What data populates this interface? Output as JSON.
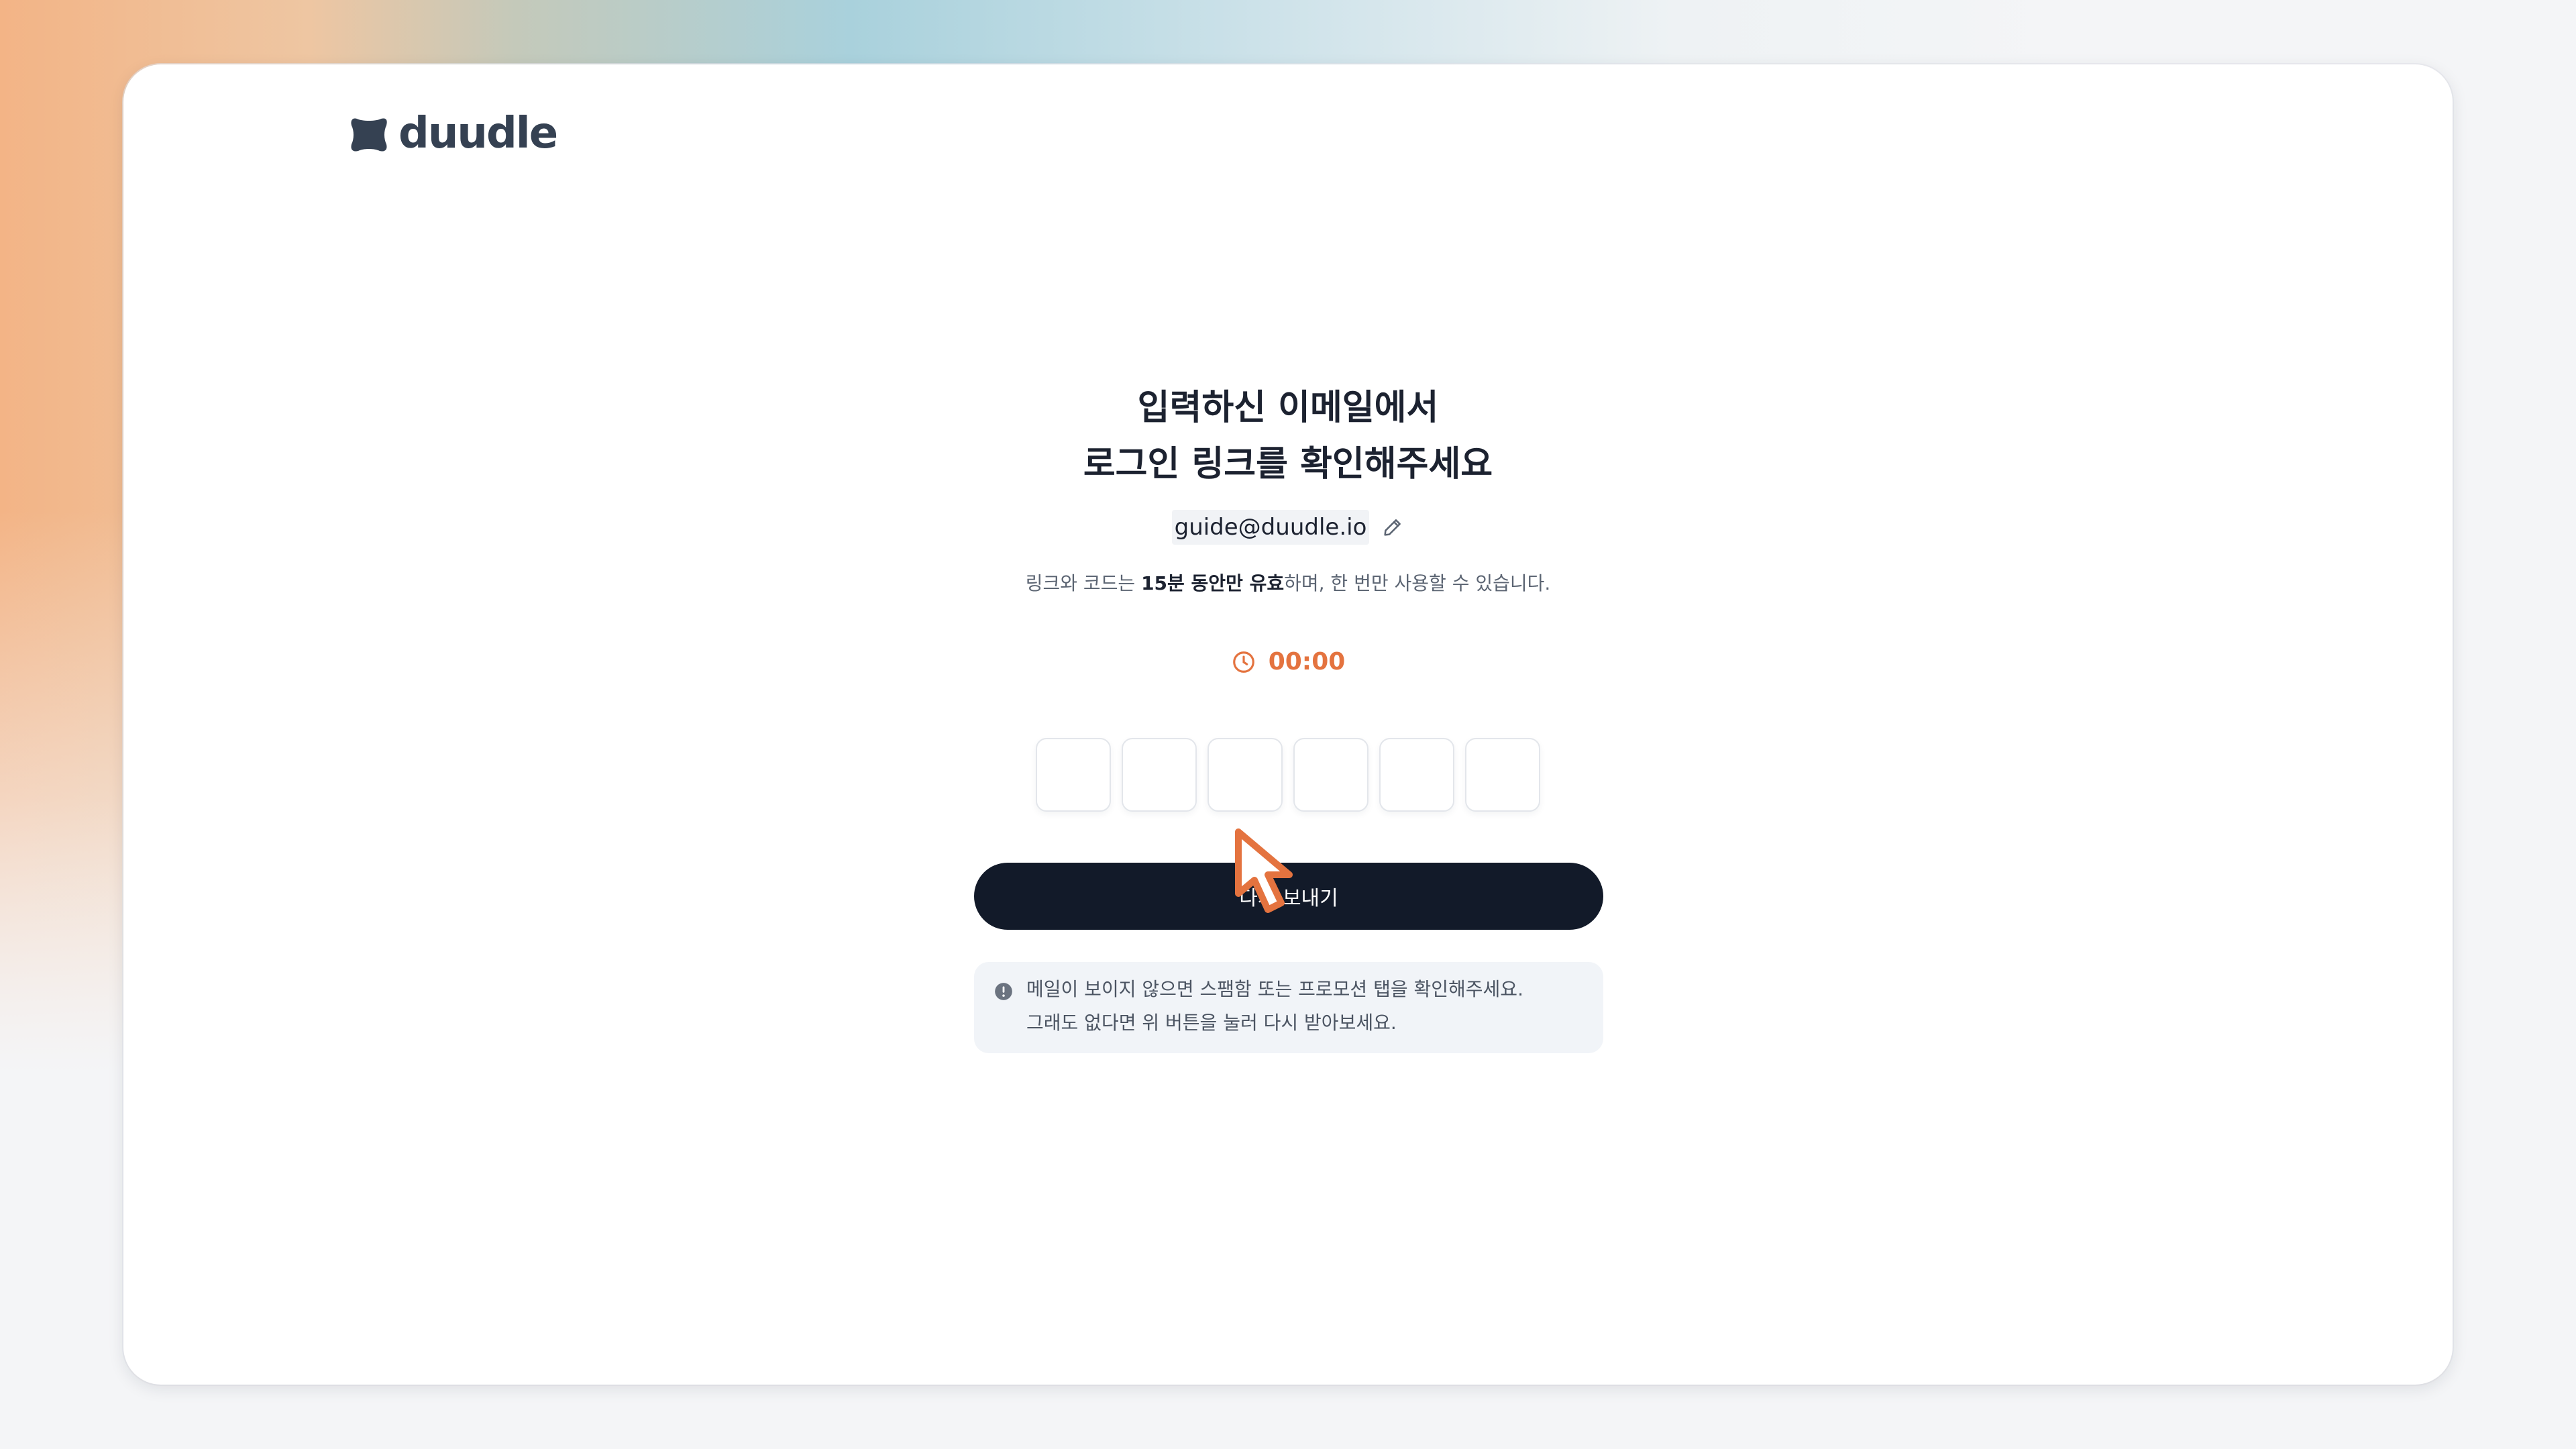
{
  "brand": {
    "name": "duudle",
    "color": "#354152"
  },
  "heading": {
    "line1": "입력하신 이메일에서",
    "line2": "로그인 링크를 확인해주세요"
  },
  "email": {
    "address": "guide@duudle.io",
    "edit_icon": "pencil-icon"
  },
  "info": {
    "prefix": "링크와 코드는 ",
    "emphasis": "15분 동안만 유효",
    "suffix": "하며, 한 번만 사용할 수 있습니다."
  },
  "timer": {
    "icon": "clock-icon",
    "value": "00:00",
    "color": "#e4733f"
  },
  "code_inputs": {
    "count": 6,
    "values": [
      "",
      "",
      "",
      "",
      "",
      ""
    ]
  },
  "resend_button": {
    "label": "다시 보내기",
    "color": "#121a29"
  },
  "notice": {
    "icon": "info-icon",
    "line1": "메일이 보이지 않으면 스팸함 또는 프로모션 탭을 확인해주세요.",
    "line2": "그래도 없다면 위 버튼을 눌러 다시 받아보세요."
  },
  "cursor": {
    "icon": "pointer-cursor-icon",
    "color": "#e4733f"
  }
}
